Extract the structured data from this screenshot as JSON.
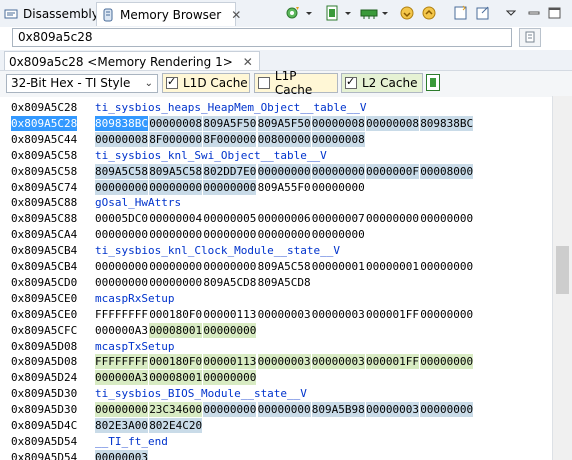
{
  "tabs": [
    {
      "label": "Disassembly",
      "active": false
    },
    {
      "label": "Memory Browser",
      "active": true
    }
  ],
  "tab_close_glyph": "✕",
  "address_input": {
    "value": "0x809a5c28"
  },
  "rendering_tab": {
    "label": "0x809a5c28 <Memory Rendering 1>"
  },
  "format_select": {
    "value": "32-Bit Hex - TI Style"
  },
  "cache_options": [
    {
      "label": "L1D Cache",
      "checked": true,
      "color": "#fff7d6"
    },
    {
      "label": "L1P Cache",
      "checked": false,
      "color": "#fff7d6"
    },
    {
      "label": "L2 Cache",
      "checked": true,
      "color": "#e6f2d4"
    }
  ],
  "colors": {
    "l1d": "#c9dbe8",
    "l2": "#d8ebc3",
    "l1d_l2": "#d8ebc3",
    "selected": "#3399ff",
    "symbol": "#0033cc"
  },
  "memory_rows": [
    {
      "addr": "0x809A5C28",
      "symbol": "ti_sysbios_heaps_HeapMem_Object__table__V"
    },
    {
      "addr": "0x809A5C28",
      "selected": true,
      "words": [
        [
          "809838BC",
          "sel"
        ],
        [
          "00000008",
          "l1d"
        ],
        [
          "809A5F50",
          "l1d"
        ],
        [
          "809A5F50",
          "l1d"
        ],
        [
          "00000008",
          "l1d"
        ],
        [
          "00000008",
          "l1d"
        ],
        [
          "809838BC",
          "l1d"
        ]
      ]
    },
    {
      "addr": "0x809A5C44",
      "words": [
        [
          "00000008",
          "l1d"
        ],
        [
          "8F000000",
          "l1d"
        ],
        [
          "8F000000",
          "l1d"
        ],
        [
          "00800000",
          "l1d"
        ],
        [
          "00000008",
          "l1d"
        ]
      ]
    },
    {
      "addr": "0x809A5C58",
      "symbol": "ti_sysbios_knl_Swi_Object__table__V"
    },
    {
      "addr": "0x809A5C58",
      "words": [
        [
          "809A5C58",
          "l1d"
        ],
        [
          "809A5C58",
          "l1d"
        ],
        [
          "802DD7E0",
          "l1d"
        ],
        [
          "00000000",
          "l1d"
        ],
        [
          "00000000",
          "l1d"
        ],
        [
          "0000000F",
          "l1d"
        ],
        [
          "00008000",
          "l1d"
        ]
      ]
    },
    {
      "addr": "0x809A5C74",
      "words": [
        [
          "00000000",
          "l1d"
        ],
        [
          "00000000",
          "l1d"
        ],
        [
          "00000000",
          "l1d"
        ],
        [
          "809A55F0",
          ""
        ],
        [
          "00000000",
          ""
        ]
      ]
    },
    {
      "addr": "0x809A5C88",
      "symbol": "gOsal_HwAttrs"
    },
    {
      "addr": "0x809A5C88",
      "words": [
        [
          "00005DC0",
          ""
        ],
        [
          "00000004",
          ""
        ],
        [
          "00000005",
          ""
        ],
        [
          "00000006",
          ""
        ],
        [
          "00000007",
          ""
        ],
        [
          "00000000",
          ""
        ],
        [
          "00000000",
          ""
        ]
      ]
    },
    {
      "addr": "0x809A5CA4",
      "words": [
        [
          "00000000",
          ""
        ],
        [
          "00000000",
          ""
        ],
        [
          "00000000",
          ""
        ],
        [
          "00000000",
          ""
        ],
        [
          "00000000",
          ""
        ]
      ]
    },
    {
      "addr": "0x809A5CB4",
      "symbol": "ti_sysbios_knl_Clock_Module__state__V"
    },
    {
      "addr": "0x809A5CB4",
      "words": [
        [
          "00000000",
          ""
        ],
        [
          "00000000",
          ""
        ],
        [
          "00000000",
          ""
        ],
        [
          "809A5C58",
          ""
        ],
        [
          "00000001",
          ""
        ],
        [
          "00000001",
          ""
        ],
        [
          "00000000",
          ""
        ]
      ]
    },
    {
      "addr": "0x809A5CD0",
      "words": [
        [
          "00000000",
          ""
        ],
        [
          "00000000",
          ""
        ],
        [
          "809A5CD8",
          ""
        ],
        [
          "809A5CD8",
          ""
        ]
      ]
    },
    {
      "addr": "0x809A5CE0",
      "symbol": "mcaspRxSetup"
    },
    {
      "addr": "0x809A5CE0",
      "words": [
        [
          "FFFFFFFF",
          ""
        ],
        [
          "000180F0",
          ""
        ],
        [
          "00000113",
          ""
        ],
        [
          "00000003",
          ""
        ],
        [
          "00000003",
          ""
        ],
        [
          "000001FF",
          ""
        ],
        [
          "00000000",
          ""
        ]
      ]
    },
    {
      "addr": "0x809A5CFC",
      "words": [
        [
          "000000A3",
          ""
        ],
        [
          "00008001",
          "l2"
        ],
        [
          "00000000",
          "l2"
        ]
      ]
    },
    {
      "addr": "0x809A5D08",
      "symbol": "mcaspTxSetup"
    },
    {
      "addr": "0x809A5D08",
      "words": [
        [
          "FFFFFFFF",
          "l2"
        ],
        [
          "000180F0",
          "l2"
        ],
        [
          "00000113",
          "l2"
        ],
        [
          "00000003",
          "l2"
        ],
        [
          "00000003",
          "l2"
        ],
        [
          "000001FF",
          "l2"
        ],
        [
          "00000000",
          "l2"
        ]
      ]
    },
    {
      "addr": "0x809A5D24",
      "words": [
        [
          "000000A3",
          "l2"
        ],
        [
          "00008001",
          "l2"
        ],
        [
          "00000000",
          "l2"
        ]
      ]
    },
    {
      "addr": "0x809A5D30",
      "symbol": "ti_sysbios_BIOS_Module__state__V"
    },
    {
      "addr": "0x809A5D30",
      "words": [
        [
          "00000000",
          "l1d_l2"
        ],
        [
          "23C34600",
          "l1d_l2"
        ],
        [
          "00000000",
          "l1d"
        ],
        [
          "00000000",
          "l1d"
        ],
        [
          "809A5B98",
          "l1d"
        ],
        [
          "00000003",
          "l1d"
        ],
        [
          "00000000",
          "l1d"
        ]
      ]
    },
    {
      "addr": "0x809A5D4C",
      "words": [
        [
          "802E3A00",
          "l1d"
        ],
        [
          "802E4C20",
          "l1d"
        ]
      ]
    },
    {
      "addr": "0x809A5D54",
      "symbol": "__TI_ft_end"
    },
    {
      "addr": "0x809A5D54",
      "words": [
        [
          "00000003",
          "l1d"
        ]
      ]
    }
  ]
}
